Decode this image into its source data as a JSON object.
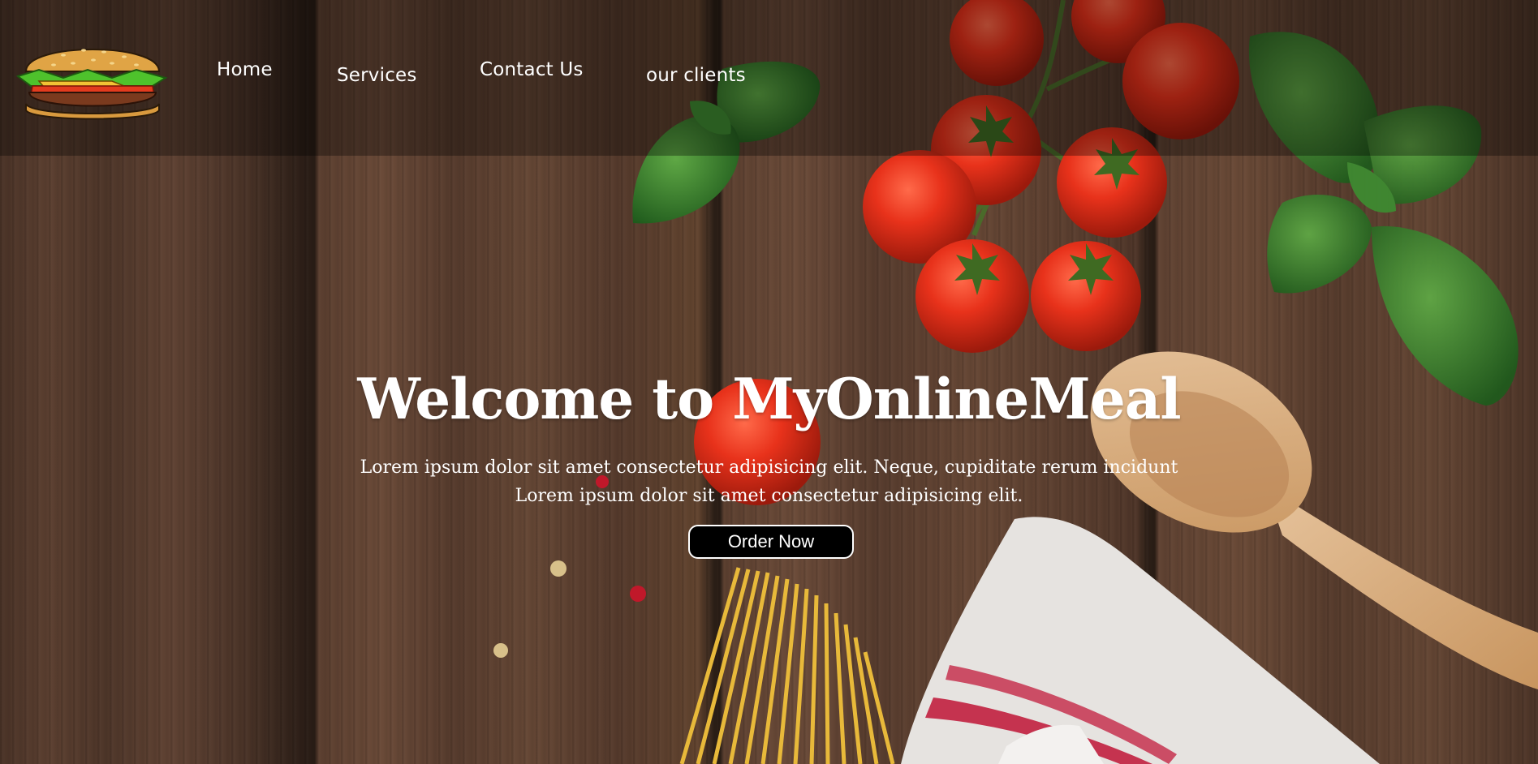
{
  "brand": {
    "logo_icon": "burger-icon"
  },
  "nav": {
    "items": [
      {
        "label": "Home"
      },
      {
        "label": "Services"
      },
      {
        "label": "Contact Us"
      },
      {
        "label": "our clients"
      }
    ]
  },
  "hero": {
    "title": "Welcome to MyOnlineMeal",
    "subtitle_line1": "Lorem ipsum dolor sit amet consectetur adipisicing elit. Neque, cupiditate rerum incidunt",
    "subtitle_line2": "Lorem ipsum dolor sit amet consectetur adipisicing elit.",
    "cta_label": "Order Now"
  },
  "colors": {
    "navbar_overlay": "#00000052",
    "text": "#ffffff",
    "button_bg": "#000000"
  }
}
